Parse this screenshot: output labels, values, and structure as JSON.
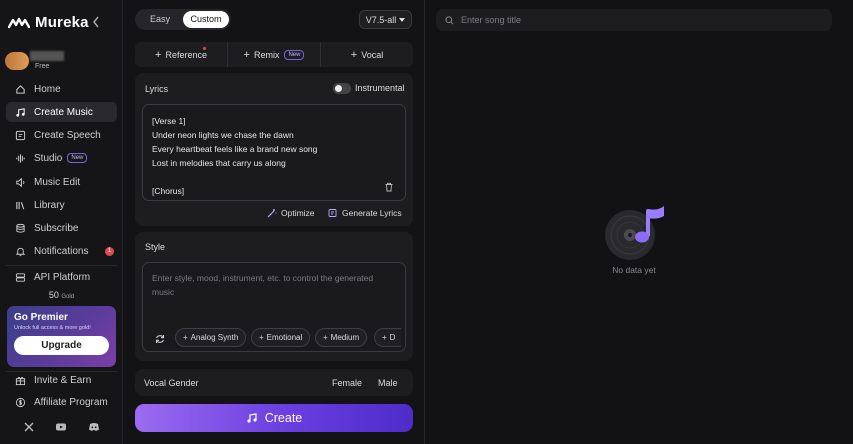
{
  "app": {
    "name": "Mureka"
  },
  "user": {
    "plan": "Free"
  },
  "sidebar": {
    "items": [
      {
        "label": "Home",
        "icon": "home-icon"
      },
      {
        "label": "Create Music",
        "icon": "music-note-icon",
        "active": true
      },
      {
        "label": "Create Speech",
        "icon": "speech-icon"
      },
      {
        "label": "Studio",
        "icon": "waveform-icon",
        "badge": "New"
      },
      {
        "label": "Music Edit",
        "icon": "speaker-icon"
      },
      {
        "label": "Library",
        "icon": "library-icon"
      },
      {
        "label": "Subscribe",
        "icon": "stack-icon"
      },
      {
        "label": "Notifications",
        "icon": "bell-icon",
        "count": "1"
      },
      {
        "label": "API Platform",
        "icon": "server-icon"
      }
    ],
    "gold": {
      "amount": "50",
      "unit": "Gold"
    },
    "premier": {
      "title": "Go Premier",
      "subtitle": "Unlock full access & more gold!",
      "button": "Upgrade"
    },
    "bottom_items": [
      {
        "label": "Invite & Earn",
        "icon": "gift-icon"
      },
      {
        "label": "Affiliate Program",
        "icon": "dollar-icon"
      }
    ],
    "social": [
      "x-icon",
      "youtube-icon",
      "discord-icon"
    ]
  },
  "mode": {
    "options": [
      "Easy",
      "Custom"
    ],
    "selected": "Custom"
  },
  "model": {
    "version": "V7.5-all"
  },
  "toolbar": {
    "reference": "Reference",
    "remix": "Remix",
    "remix_badge": "New",
    "vocal": "Vocal"
  },
  "lyrics": {
    "label": "Lyrics",
    "instrumental_label": "Instrumental",
    "instrumental": false,
    "lines": [
      "[Verse 1]",
      "Under neon lights we chase the dawn",
      "Every heartbeat feels like a brand new song",
      "Lost in melodies that carry us along",
      "",
      "[Chorus]"
    ],
    "optimize": "Optimize",
    "generate": "Generate Lyrics"
  },
  "style": {
    "label": "Style",
    "placeholder": "Enter style, mood, instrument, etc. to control the generated music",
    "chips": [
      "Analog Synth",
      "Emotional",
      "Medium",
      "D"
    ]
  },
  "vocal_gender": {
    "label": "Vocal Gender",
    "options": [
      "Female",
      "Male"
    ]
  },
  "create": {
    "label": "Create"
  },
  "search": {
    "placeholder": "Enter song title"
  },
  "empty": {
    "text": "No data yet"
  },
  "colors": {
    "accent": "#7b55f0",
    "bg": "#121214",
    "card": "#1d1d20"
  }
}
